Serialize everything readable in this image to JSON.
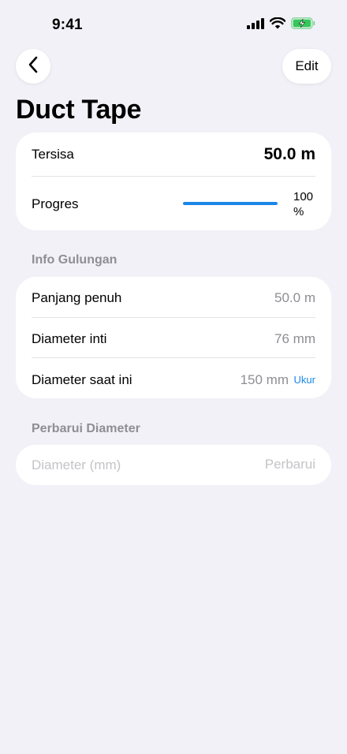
{
  "status_bar": {
    "time": "9:41"
  },
  "nav": {
    "back_icon": "chevron-left-icon",
    "edit_label": "Edit"
  },
  "title": "Duct Tape",
  "summary": {
    "remaining_label": "Tersisa",
    "remaining_value": "50.0 m",
    "progress_label": "Progres",
    "progress_percent": 100,
    "progress_text": "100 %"
  },
  "roll_info": {
    "header": "Info Gulungan",
    "full_length_label": "Panjang penuh",
    "full_length_value": "50.0 m",
    "core_diameter_label": "Diameter inti",
    "core_diameter_value": "76 mm",
    "current_diameter_label": "Diameter saat ini",
    "current_diameter_value": "150 mm",
    "measure_label": "Ukur"
  },
  "update_diameter": {
    "header": "Perbarui Diameter",
    "input_placeholder": "Diameter (mm)",
    "input_value": "",
    "update_label": "Perbarui"
  },
  "colors": {
    "background": "#f2f1f7",
    "accent": "#1a86e8",
    "secondary_text": "#8e8e93",
    "battery_charging": "#34c759"
  }
}
